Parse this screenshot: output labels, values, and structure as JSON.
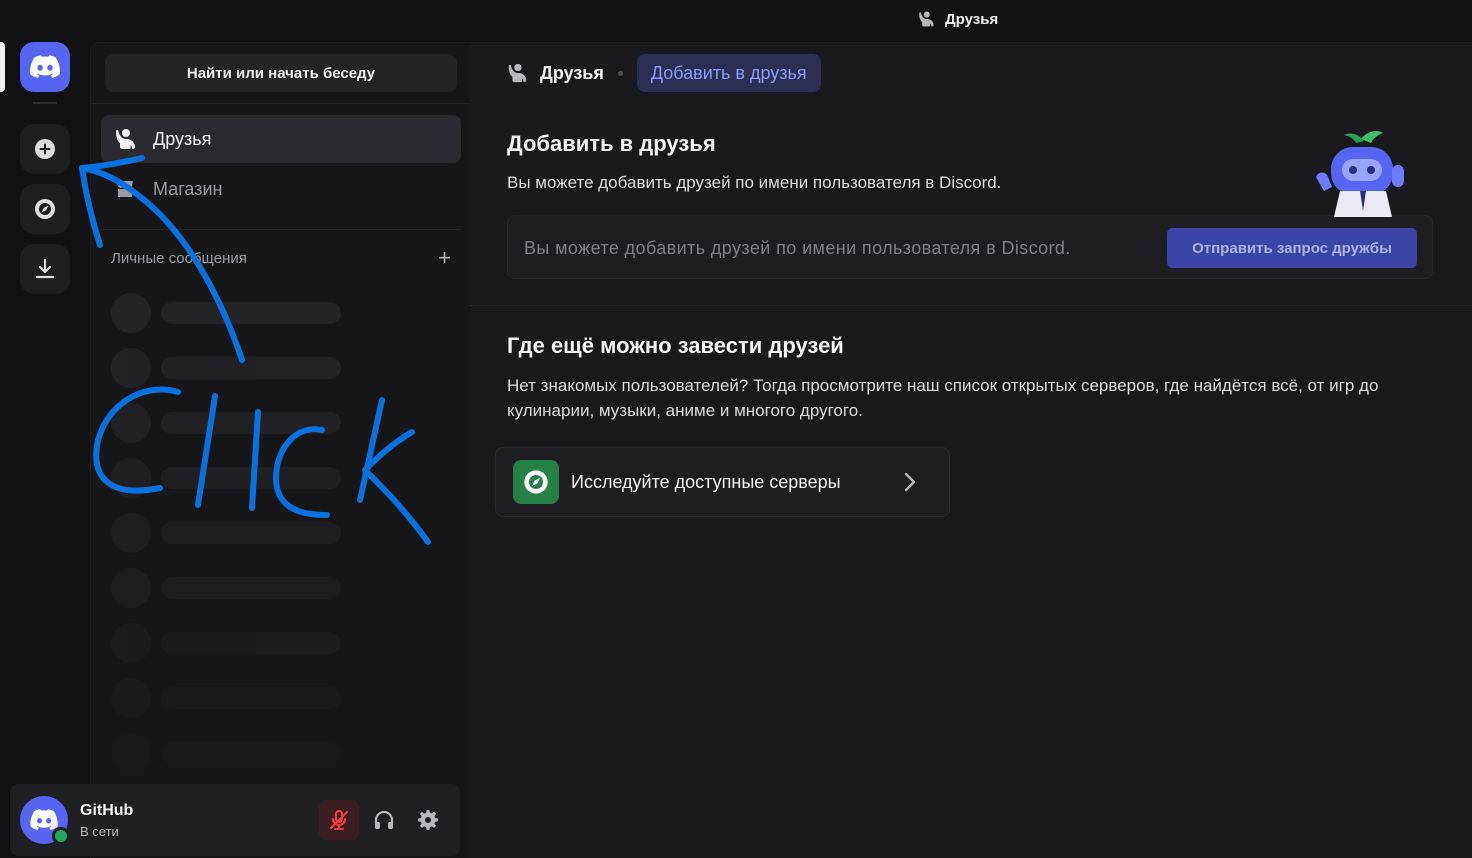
{
  "titlebar": {
    "title": "Друзья",
    "icon": "friends-icon"
  },
  "rail": {
    "home_icon": "discord-logo-icon",
    "add_server_icon": "plus-circle-icon",
    "discover_icon": "compass-icon",
    "download_icon": "download-icon"
  },
  "sidebar": {
    "search_label": "Найти или начать беседу",
    "nav": [
      {
        "label": "Друзья",
        "icon": "friends-icon",
        "active": true
      },
      {
        "label": "Магазин",
        "icon": "shop-icon",
        "active": false
      }
    ],
    "dm_header": "Личные сообщения",
    "dm_add_icon": "plus-icon"
  },
  "user": {
    "name": "GitHub",
    "status": "В сети",
    "status_color": "#23a55a",
    "controls": [
      "mic-muted-icon",
      "headphones-icon",
      "gear-icon"
    ]
  },
  "header": {
    "friends_label": "Друзья",
    "add_friend_label": "Добавить в друзья"
  },
  "add_friend": {
    "title": "Добавить в друзья",
    "description": "Вы можете добавить друзей по имени пользователя в Discord.",
    "input_placeholder": "Вы можете добавить друзей по имени пользователя в Discord.",
    "send_label": "Отправить запрос дружбы"
  },
  "where": {
    "title": "Где ещё можно завести друзей",
    "description": "Нет знакомых пользователей? Тогда просмотрите наш список открытых серверов, где найдётся всё, от игр до кулинарии, музыки, аниме и многого другого.",
    "explore_label": "Исследуйте доступные серверы"
  },
  "annotation": {
    "text": "Click",
    "color": "#0a72e0"
  },
  "colors": {
    "accent": "#5865f2",
    "accent_text": "#8d99ff",
    "explore_green": "#248046"
  }
}
